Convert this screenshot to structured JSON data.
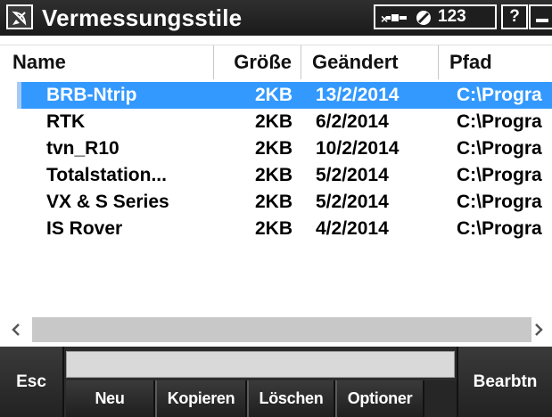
{
  "window": {
    "title": "Vermessungsstile",
    "status_number": "123",
    "help_label": "?",
    "close_label": "×"
  },
  "list": {
    "columns": [
      "Name",
      "Größe",
      "Geändert",
      "Pfad"
    ],
    "rows": [
      {
        "name": "BRB-Ntrip",
        "size": "2KB",
        "date": "13/2/2014",
        "path": "C:\\Progra",
        "selected": true
      },
      {
        "name": "RTK",
        "size": "2KB",
        "date": "6/2/2014",
        "path": "C:\\Progra",
        "selected": false
      },
      {
        "name": "tvn_R10",
        "size": "2KB",
        "date": "10/2/2014",
        "path": "C:\\Progra",
        "selected": false
      },
      {
        "name": "Totalstation...",
        "size": "2KB",
        "date": "5/2/2014",
        "path": "C:\\Progra",
        "selected": false
      },
      {
        "name": "VX & S Series",
        "size": "2KB",
        "date": "5/2/2014",
        "path": "C:\\Progra",
        "selected": false
      },
      {
        "name": "IS Rover",
        "size": "2KB",
        "date": "4/2/2014",
        "path": "C:\\Progra",
        "selected": false
      }
    ]
  },
  "softkeys": {
    "esc": "Esc",
    "neu": "Neu",
    "kopieren": "Kopieren",
    "loeschen": "Löschen",
    "optionen": "Optioner",
    "bearbeiten": "Bearbtn"
  },
  "icons": {
    "app": "satellite-dish-icon",
    "gnss": "satellite-icon",
    "no_signal": "no-signal-icon",
    "scroll_left": "chevron-left-icon",
    "scroll_right": "chevron-right-icon"
  },
  "colors": {
    "selection": "#3399ff",
    "titlebar": "#1f1f1f",
    "softbar": "#2c2c2c"
  }
}
